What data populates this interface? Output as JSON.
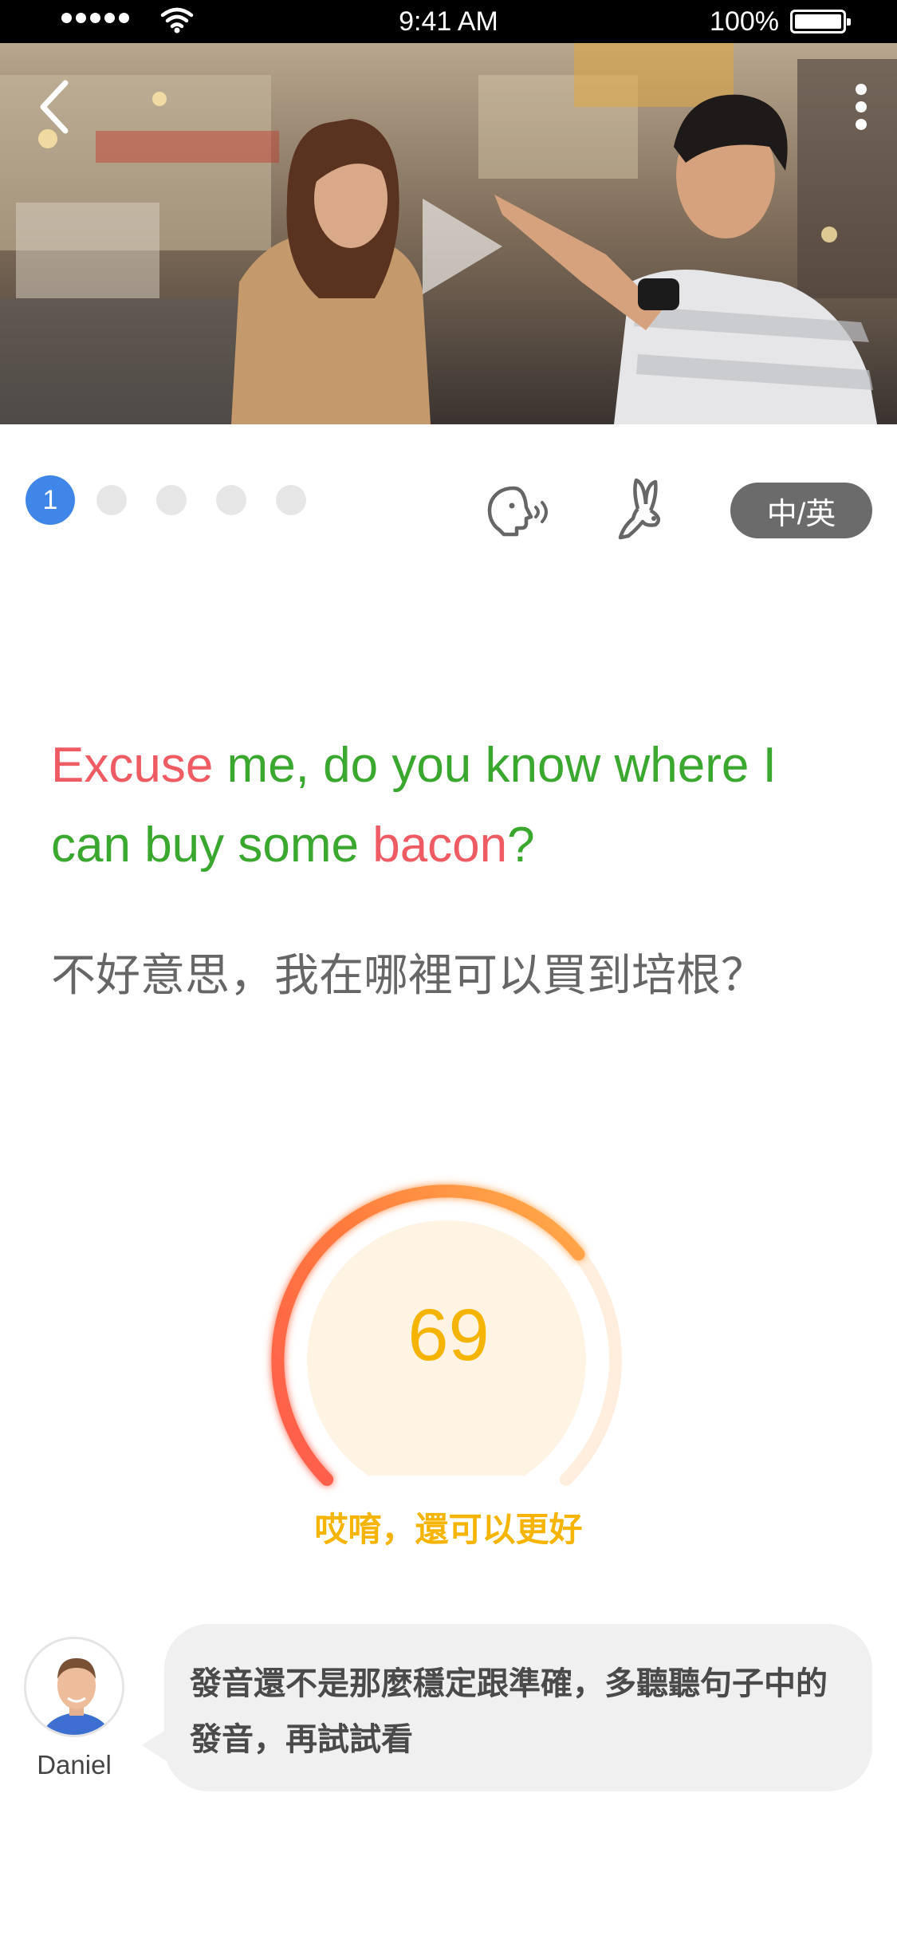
{
  "status_bar": {
    "time": "9:41 AM",
    "battery": "100%"
  },
  "video": {
    "back_icon": "chevron-left-icon",
    "more_icon": "more-vertical-icon",
    "play_icon": "play-icon"
  },
  "progress": {
    "current": "1",
    "total_steps": 5
  },
  "controls": {
    "speak_icon": "speak-head-icon",
    "slow_icon": "rabbit-icon",
    "lang_toggle_label": "中/英"
  },
  "sentence": {
    "en_words": [
      {
        "text": "Excuse",
        "status": "bad"
      },
      {
        "text": " me, do you know where I can buy some ",
        "status": "good"
      },
      {
        "text": "bacon",
        "status": "bad"
      },
      {
        "text": "?",
        "status": "good"
      }
    ],
    "zh": "不好意思，我在哪裡可以買到培根？"
  },
  "score": {
    "value": "69",
    "max": 100,
    "message": "哎唷，還可以更好"
  },
  "tutor": {
    "name": "Daniel",
    "feedback": "發音還不是那麼穩定跟準確，多聽聽句子中的發音，再試試看"
  },
  "colors": {
    "correct": "#3aa72e",
    "incorrect": "#ef5b63",
    "score": "#f5b400",
    "active_dot": "#3f86e8"
  }
}
